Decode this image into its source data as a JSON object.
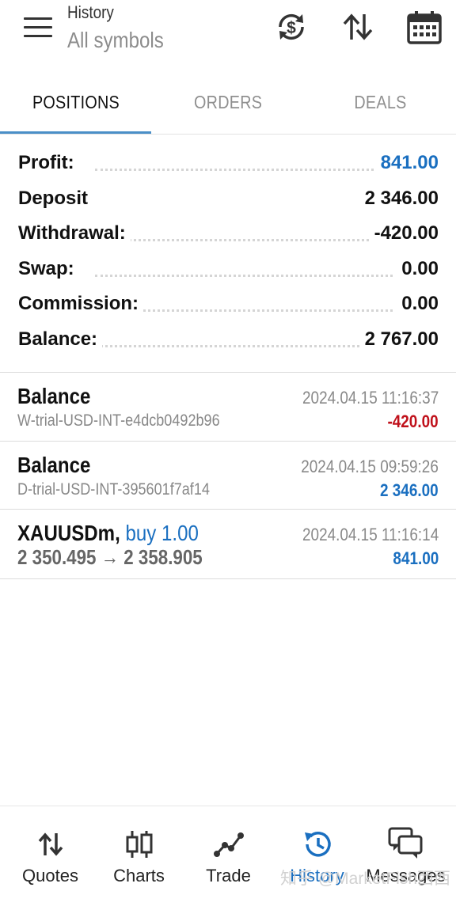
{
  "header": {
    "title": "History",
    "subtitle": "All symbols",
    "icons": [
      "menu-icon",
      "currency-exchange-icon",
      "sort-icon",
      "calendar-icon"
    ]
  },
  "tabs": [
    {
      "label": "POSITIONS",
      "active": true
    },
    {
      "label": "ORDERS",
      "active": false
    },
    {
      "label": "DEALS",
      "active": false
    }
  ],
  "summary": [
    {
      "label": "Profit:",
      "value": "841.00",
      "color": "#1a6fc0"
    },
    {
      "label": "Deposit",
      "value": "2 346.00",
      "color": "#111111"
    },
    {
      "label": "Withdrawal:",
      "value": "-420.00",
      "color": "#111111"
    },
    {
      "label": "Swap:",
      "value": "0.00",
      "color": "#111111"
    },
    {
      "label": "Commission:",
      "value": "0.00",
      "color": "#111111"
    },
    {
      "label": "Balance:",
      "value": "2 767.00",
      "color": "#111111"
    }
  ],
  "deals": [
    {
      "title": "Balance",
      "subtitle": "W-trial-USD-INT-e4dcb0492b96",
      "time": "2024.04.15 11:16:37",
      "amount": "-420.00",
      "amount_color": "#c0111b"
    },
    {
      "title": "Balance",
      "subtitle": "D-trial-USD-INT-395601f7af14",
      "time": "2024.04.15 09:59:26",
      "amount": "2 346.00",
      "amount_color": "#1a6fc0"
    },
    {
      "symbol": "XAUUSDm,",
      "side": "buy 1.00",
      "prices": "2 350.495 → 2 358.905",
      "time": "2024.04.15 11:16:14",
      "amount": "841.00",
      "amount_color": "#1a6fc0"
    }
  ],
  "nav": [
    {
      "label": "Quotes",
      "icon": "quotes-icon"
    },
    {
      "label": "Charts",
      "icon": "charts-icon"
    },
    {
      "label": "Trade",
      "icon": "trade-icon"
    },
    {
      "label": "History",
      "icon": "history-icon",
      "active": true
    },
    {
      "label": "Messages",
      "icon": "messages-icon"
    }
  ],
  "watermark": "知乎 @MarketFish西西",
  "colors": {
    "accent": "#1a6fc0",
    "negative": "#c0111b",
    "tab_underline": "#4a8fc7"
  }
}
